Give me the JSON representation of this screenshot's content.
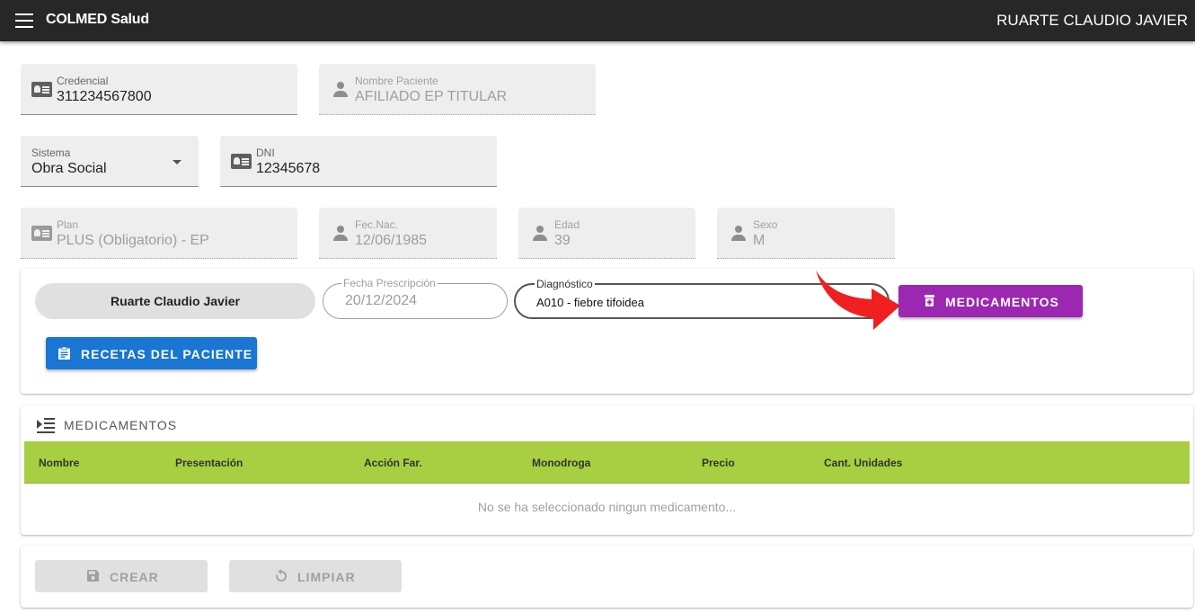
{
  "app": {
    "title": "COLMED Salud",
    "user": "RUARTE CLAUDIO JAVIER"
  },
  "form": {
    "credencial": {
      "label": "Credencial",
      "value": "311234567800"
    },
    "nombre_paciente": {
      "label": "Nombre Paciente",
      "value": "AFILIADO EP TITULAR"
    },
    "sistema": {
      "label": "Sistema",
      "value": "Obra Social"
    },
    "dni": {
      "label": "DNI",
      "value": "12345678"
    },
    "plan": {
      "label": "Plan",
      "value": "PLUS (Obligatorio) - EP"
    },
    "fec_nac": {
      "label": "Fec.Nac.",
      "value": "12/06/1985"
    },
    "edad": {
      "label": "Edad",
      "value": "39"
    },
    "sexo": {
      "label": "Sexo",
      "value": "M"
    }
  },
  "prescription": {
    "doctor": "Ruarte Claudio Javier",
    "fecha": {
      "label": "Fecha Prescripción",
      "value": "20/12/2024"
    },
    "diagnostico": {
      "label": "Diagnóstico",
      "value": "A010 - fiebre tifoidea"
    },
    "medicamentos_button": "MEDICAMENTOS",
    "recetas_button": "RECETAS DEL PACIENTE"
  },
  "medicamentos": {
    "title": "MEDICAMENTOS",
    "columns": [
      "Nombre",
      "Presentación",
      "Acción Far.",
      "Monodroga",
      "Precio",
      "Cant. Unidades"
    ],
    "empty_text": "No se ha seleccionado ningun medicamento..."
  },
  "actions": {
    "crear": "CREAR",
    "limpiar": "LIMPIAR"
  },
  "colors": {
    "appbar": "#272727",
    "accent_purple": "#9c27b0",
    "primary_blue": "#1976d2",
    "table_header": "#a7cf41",
    "arrow": "#f02020"
  }
}
